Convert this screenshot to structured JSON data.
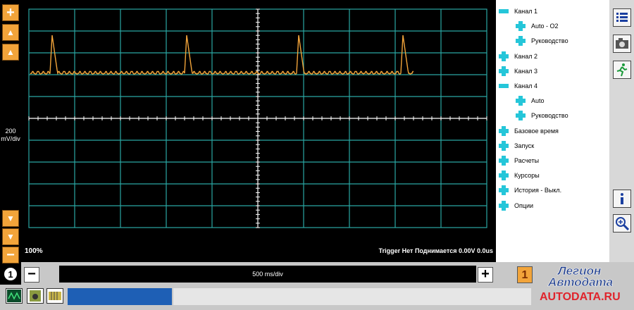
{
  "scope": {
    "vscale": [
      "200",
      "mV/div"
    ],
    "zoom": "100%",
    "trigger_status": "Trigger Нет Поднимается 0.00V 0.0us",
    "timebase": "500 ms/div",
    "channel_number": "1",
    "trace_color": "#f2a43a"
  },
  "tree": {
    "items": [
      {
        "label": "Канал 1",
        "icon": "minus-icon",
        "level": 0
      },
      {
        "label": "Auto - O2",
        "icon": "plus-icon",
        "level": 1
      },
      {
        "label": "Руководство",
        "icon": "plus-icon",
        "level": 1
      },
      {
        "label": "Канал 2",
        "icon": "plus-icon",
        "level": 0
      },
      {
        "label": "Канал 3",
        "icon": "plus-icon",
        "level": 0
      },
      {
        "label": "Канал 4",
        "icon": "minus-icon",
        "level": 0
      },
      {
        "label": "Auto",
        "icon": "plus-icon",
        "level": 1
      },
      {
        "label": "Руководство",
        "icon": "plus-icon",
        "level": 1
      },
      {
        "label": "Базовое время",
        "icon": "plus-icon",
        "level": 0
      },
      {
        "label": "Запуск",
        "icon": "plus-icon",
        "level": 0
      },
      {
        "label": "Расчеты",
        "icon": "plus-icon",
        "level": 0
      },
      {
        "label": "Курсоры",
        "icon": "plus-icon",
        "level": 0
      },
      {
        "label": "История - Выкл.",
        "icon": "plus-icon",
        "level": 0
      },
      {
        "label": "Опции",
        "icon": "plus-icon",
        "level": 0
      }
    ]
  },
  "bottom_right": {
    "channel_select": "1"
  },
  "logo": {
    "line1": "Легион",
    "line2": "Автодата",
    "url": "AUTODATA.RU"
  }
}
